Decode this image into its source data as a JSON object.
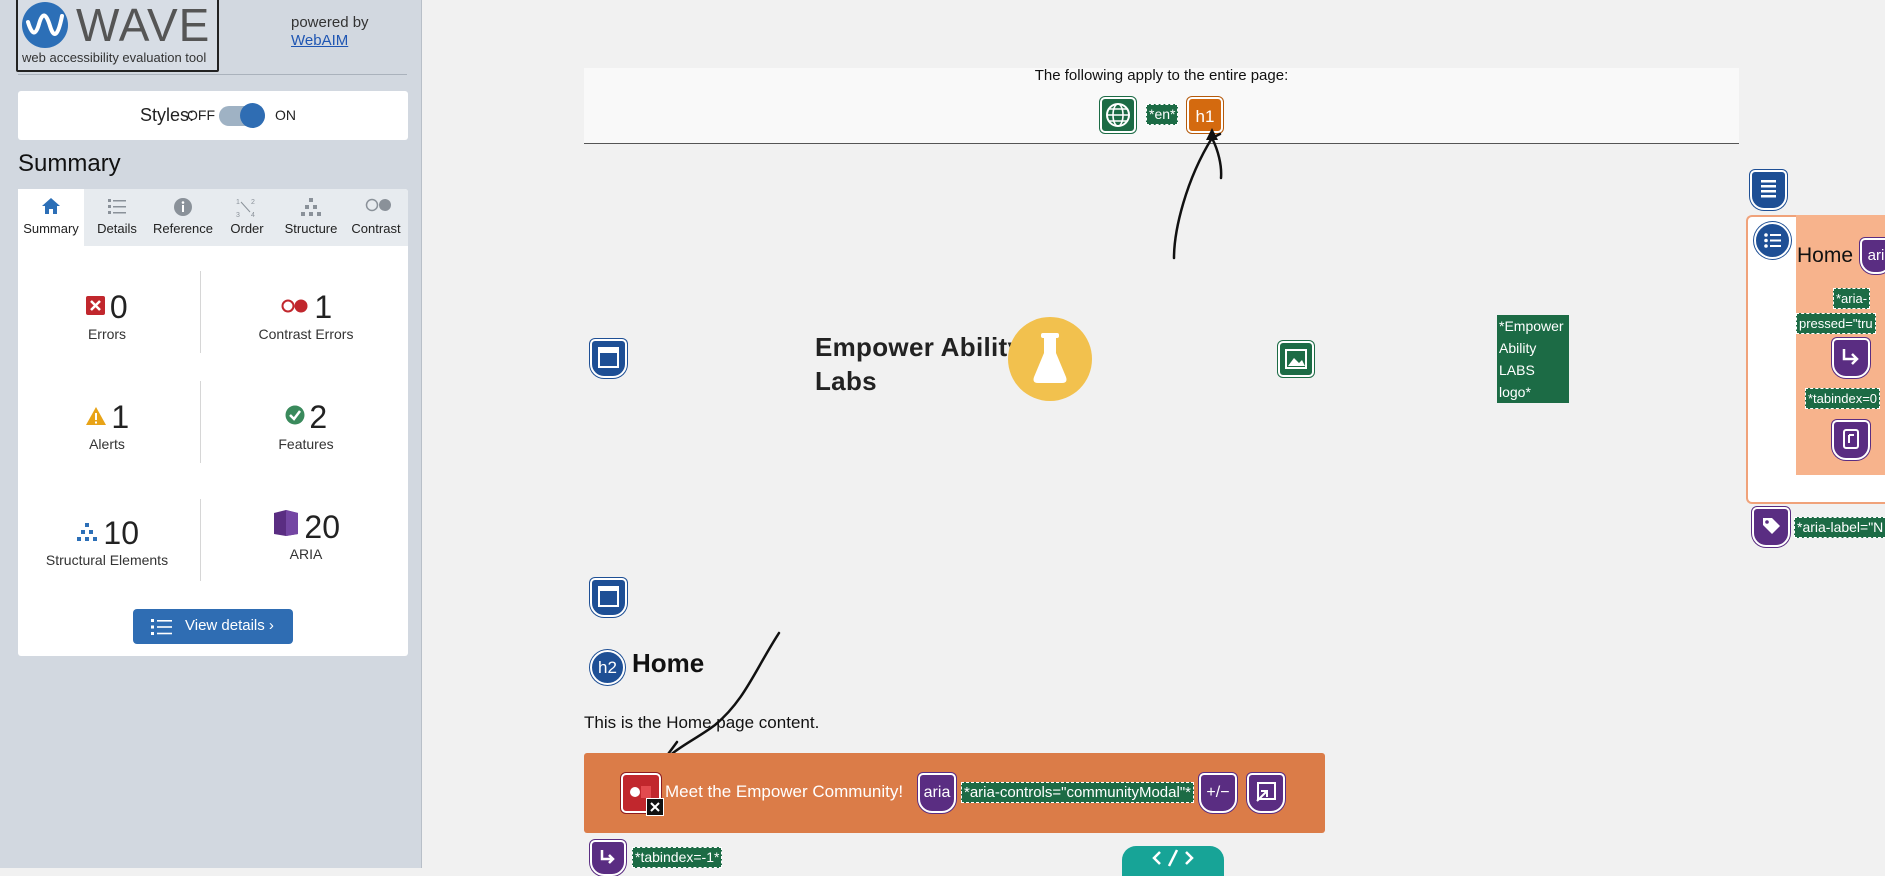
{
  "sidebar": {
    "logo": {
      "word": "WAVE",
      "tagline": "web accessibility evaluation tool"
    },
    "powered_by": "powered by",
    "webaim_link": "WebAIM",
    "styles": {
      "label": "Styles:",
      "off": "OFF",
      "on": "ON",
      "state": "on"
    },
    "summary_heading": "Summary",
    "tabs": [
      {
        "label": "Summary",
        "icon": "home-icon",
        "active": true
      },
      {
        "label": "Details",
        "icon": "list-icon"
      },
      {
        "label": "Reference",
        "icon": "info-icon"
      },
      {
        "label": "Order",
        "icon": "order-icon"
      },
      {
        "label": "Structure",
        "icon": "structure-icon"
      },
      {
        "label": "Contrast",
        "icon": "contrast-icon"
      }
    ],
    "stats": {
      "errors": {
        "count": "0",
        "label": "Errors",
        "color": "#c1272d"
      },
      "contrast": {
        "count": "1",
        "label": "Contrast Errors",
        "color": "#c1272d"
      },
      "alerts": {
        "count": "1",
        "label": "Alerts",
        "color": "#e8a317"
      },
      "features": {
        "count": "2",
        "label": "Features",
        "color": "#3a8a5c"
      },
      "structural": {
        "count": "10",
        "label": "Structural Elements",
        "color": "#2c6fb7"
      },
      "aria": {
        "count": "20",
        "label": "ARIA",
        "color": "#5a2d82"
      }
    },
    "view_details": "View details ›"
  },
  "page": {
    "banner_text": "The following apply to the entire page:",
    "lang_tag": "*en*",
    "h1_badge": "h1",
    "brand_line1": "Empower Ability",
    "brand_line2": "Labs",
    "logo_alt_lines": [
      "*Empower",
      "Ability",
      "LABS",
      "logo*"
    ],
    "h2_badge": "h2",
    "home_heading": "Home",
    "home_text": "This is the Home page content.",
    "button_text": "Meet the Empower Community!",
    "aria_badge": "aria",
    "aria_controls": "*aria-controls=\"communityModal\"*",
    "plusminus": "+/−",
    "tabindex_bottom": "*tabindex=-1*",
    "right": {
      "home": "Home",
      "aria_badge": "ari",
      "pressed_1": "*aria-",
      "pressed_2": "pressed=\"tru",
      "tabindex": "*tabindex=0",
      "aria_label": "*aria-label=\"N"
    }
  }
}
